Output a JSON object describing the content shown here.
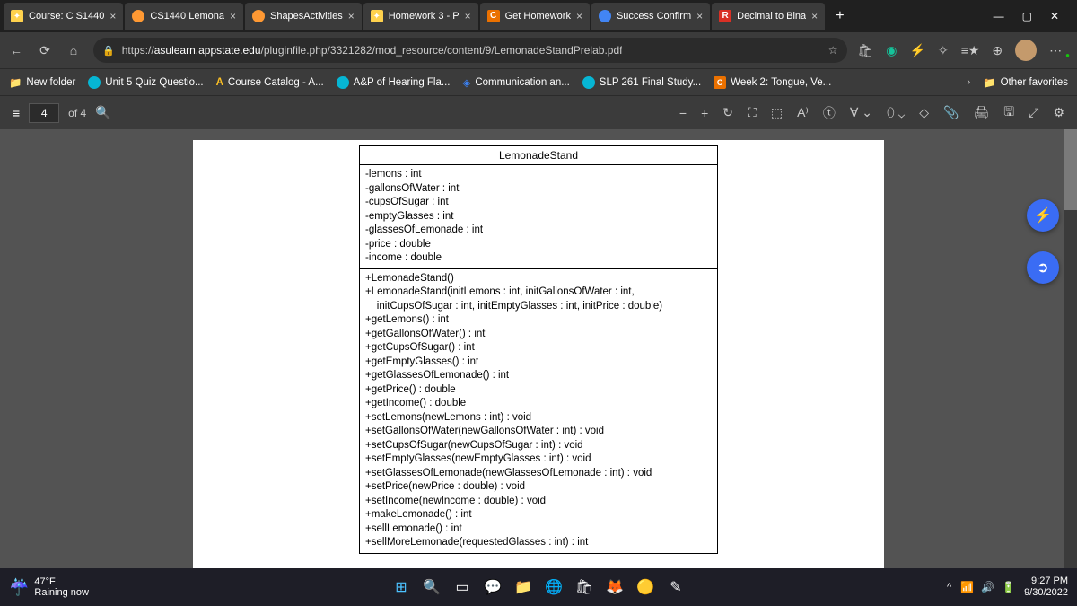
{
  "tabs": [
    {
      "title": "Course: C S1440"
    },
    {
      "title": "CS1440 Lemona"
    },
    {
      "title": "ShapesActivities"
    },
    {
      "title": "Homework 3 - P"
    },
    {
      "title": "Get Homework"
    },
    {
      "title": "Success Confirm"
    },
    {
      "title": "Decimal to Bina"
    }
  ],
  "url": {
    "scheme": "https://",
    "domain": "asulearn.appstate.edu",
    "path": "/pluginfile.php/3321282/mod_resource/content/9/LemonadeStandPrelab.pdf"
  },
  "favorites": [
    {
      "label": "New folder"
    },
    {
      "label": "Unit 5 Quiz Questio..."
    },
    {
      "label": "Course Catalog - A..."
    },
    {
      "label": "A&P of Hearing Fla..."
    },
    {
      "label": "Communication an..."
    },
    {
      "label": "SLP 261 Final Study..."
    },
    {
      "label": "Week 2: Tongue, Ve..."
    }
  ],
  "other_favorites": "Other favorites",
  "pdf": {
    "current_page": "4",
    "page_of": "of 4"
  },
  "uml": {
    "class_name": "LemonadeStand",
    "attributes": [
      "-lemons : int",
      "-gallonsOfWater : int",
      "-cupsOfSugar : int",
      "-emptyGlasses : int",
      "-glassesOfLemonade : int",
      "-price : double",
      "-income : double"
    ],
    "methods": [
      "+LemonadeStand()",
      "+LemonadeStand(initLemons : int, initGallonsOfWater : int,",
      "    initCupsOfSugar : int, initEmptyGlasses : int, initPrice : double)",
      "+getLemons() : int",
      "+getGallonsOfWater() : int",
      "+getCupsOfSugar() : int",
      "+getEmptyGlasses() : int",
      "+getGlassesOfLemonade() : int",
      "+getPrice() : double",
      "+getIncome() : double",
      "+setLemons(newLemons : int) : void",
      "+setGallonsOfWater(newGallonsOfWater : int) : void",
      "+setCupsOfSugar(newCupsOfSugar : int) : void",
      "+setEmptyGlasses(newEmptyGlasses : int) : void",
      "+setGlassesOfLemonade(newGlassesOfLemonade : int) : void",
      "+setPrice(newPrice : double) : void",
      "+setIncome(newIncome : double) : void",
      "+makeLemonade() : int",
      "+sellLemonade() : int",
      "+sellMoreLemonade(requestedGlasses : int) : int"
    ]
  },
  "weather": {
    "temp": "47°F",
    "desc": "Raining now"
  },
  "clock": {
    "time": "9:27 PM",
    "date": "9/30/2022"
  }
}
